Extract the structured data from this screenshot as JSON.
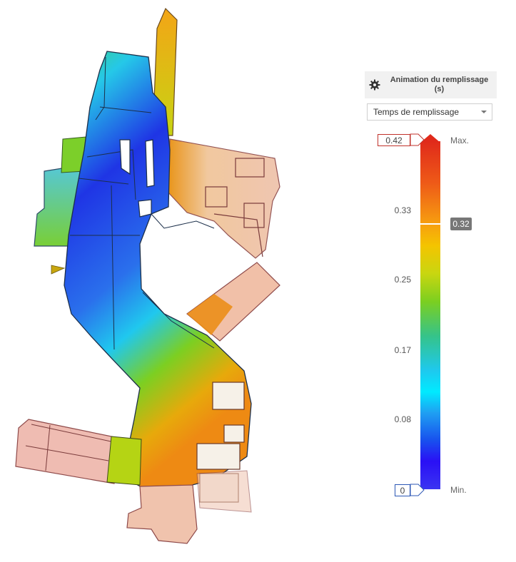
{
  "legend": {
    "title": "Animation du remplissage (s)",
    "result_select": "Temps de remplissage",
    "max_label": "Max.",
    "min_label": "Min.",
    "max_value": "0.42",
    "min_value": "0",
    "current_value": "0.32",
    "ticks": [
      "0.33",
      "0.25",
      "0.17",
      "0.08"
    ]
  },
  "icons": {
    "settings": "gear-icon",
    "dropdown": "chevron-down-icon",
    "injection": "injection-point-icon"
  },
  "colors": {
    "max_outline": "#c0322b",
    "min_outline": "#2c57b5",
    "badge": "#777777"
  }
}
